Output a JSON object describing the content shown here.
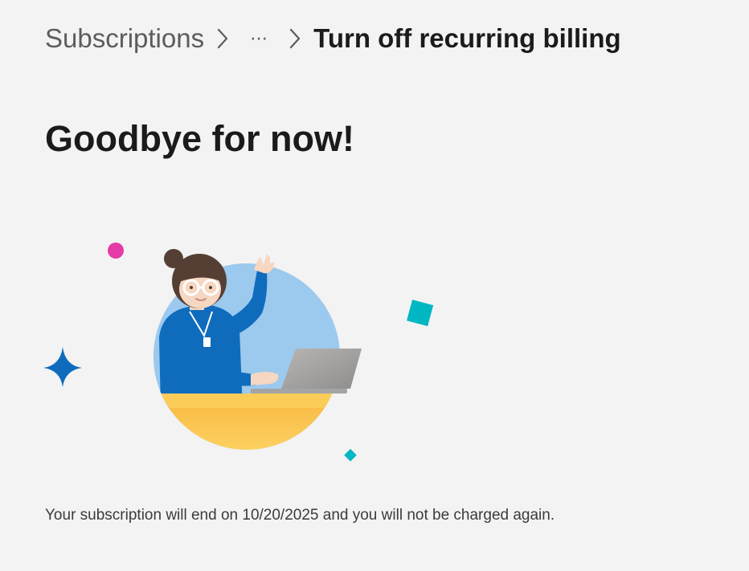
{
  "breadcrumb": {
    "root_label": "Subscriptions",
    "overflow_label": "⋯",
    "current_label": "Turn off recurring billing"
  },
  "main": {
    "title": "Goodbye for now!",
    "message": "Your subscription will end on 10/20/2025 and you will not be charged again."
  },
  "illustration": {
    "icons": [
      "pink-dot-icon",
      "blue-sparkle-icon",
      "teal-square-icon",
      "teal-diamond-icon"
    ],
    "colors": {
      "circle": "#9cc9ee",
      "desk": "#fbcd58",
      "shirt": "#0f6cbd",
      "laptop": "#a4a4a4",
      "hair": "#553f34",
      "pink": "#e43ba6",
      "teal": "#00b7c3",
      "sparkle": "#0f6cbd"
    }
  }
}
